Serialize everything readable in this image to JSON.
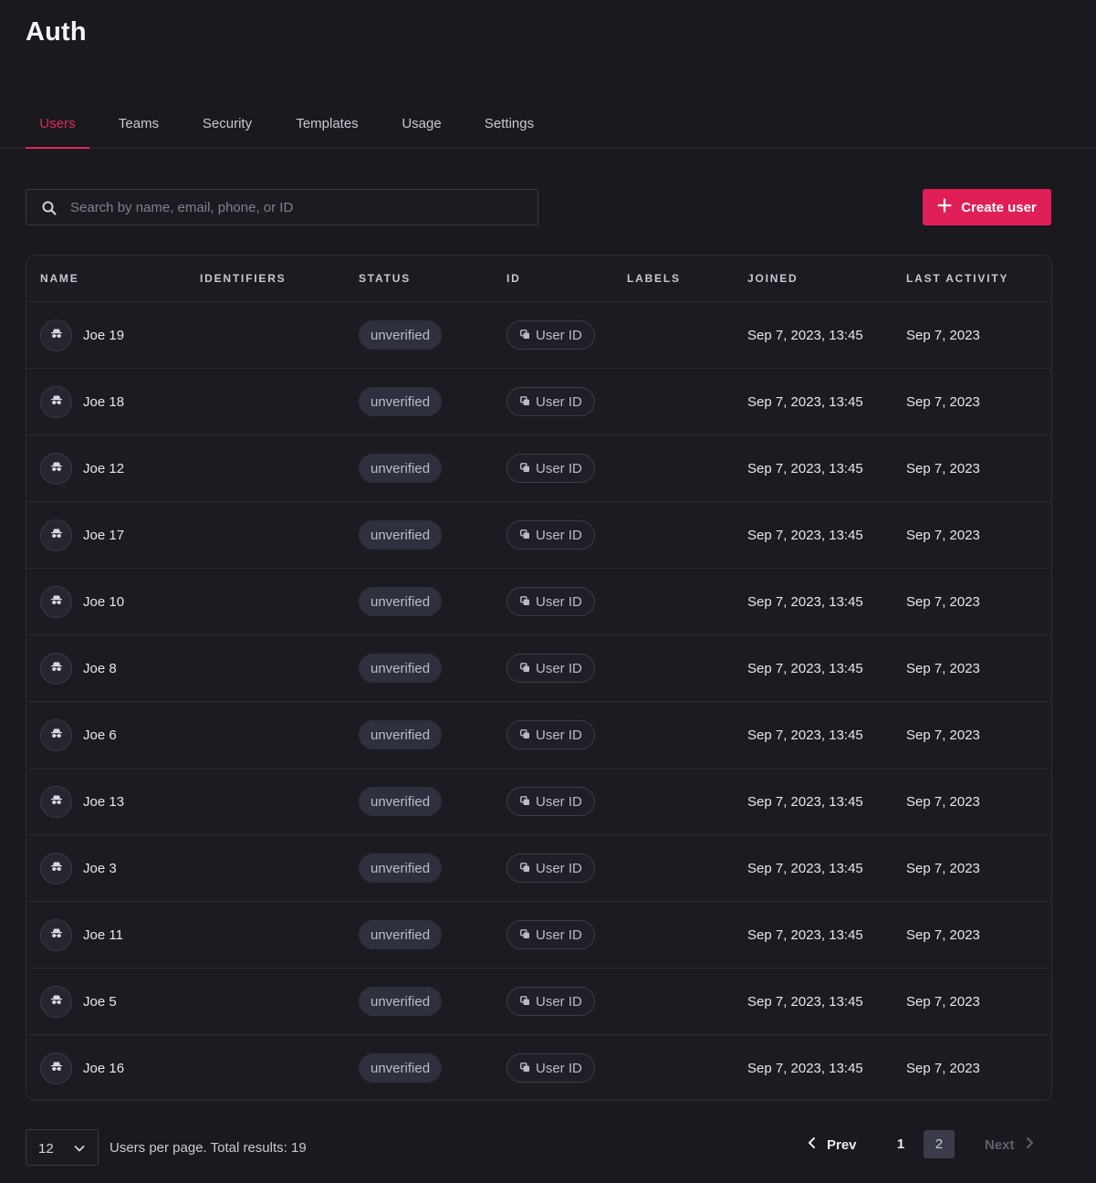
{
  "page": {
    "title": "Auth"
  },
  "tabs": [
    {
      "label": "Users",
      "active": true
    },
    {
      "label": "Teams"
    },
    {
      "label": "Security"
    },
    {
      "label": "Templates"
    },
    {
      "label": "Usage"
    },
    {
      "label": "Settings"
    }
  ],
  "search": {
    "placeholder": "Search by name, email, phone, or ID",
    "value": "",
    "icon": "search-icon"
  },
  "create_button": {
    "label": "Create user",
    "icon": "plus-icon",
    "color": "#e01e57"
  },
  "accent_color": "#e2275a",
  "table": {
    "columns": [
      "Name",
      "Identifiers",
      "Status",
      "ID",
      "Labels",
      "Joined",
      "Last Activity"
    ],
    "rows": [
      {
        "name": "Joe 19",
        "identifiers": "",
        "status": "unverified",
        "id_label": "User ID",
        "labels": "",
        "joined": "Sep 7, 2023, 13:45",
        "last_activity": "Sep 7, 2023"
      },
      {
        "name": "Joe 18",
        "identifiers": "",
        "status": "unverified",
        "id_label": "User ID",
        "labels": "",
        "joined": "Sep 7, 2023, 13:45",
        "last_activity": "Sep 7, 2023"
      },
      {
        "name": "Joe 12",
        "identifiers": "",
        "status": "unverified",
        "id_label": "User ID",
        "labels": "",
        "joined": "Sep 7, 2023, 13:45",
        "last_activity": "Sep 7, 2023"
      },
      {
        "name": "Joe 17",
        "identifiers": "",
        "status": "unverified",
        "id_label": "User ID",
        "labels": "",
        "joined": "Sep 7, 2023, 13:45",
        "last_activity": "Sep 7, 2023"
      },
      {
        "name": "Joe 10",
        "identifiers": "",
        "status": "unverified",
        "id_label": "User ID",
        "labels": "",
        "joined": "Sep 7, 2023, 13:45",
        "last_activity": "Sep 7, 2023"
      },
      {
        "name": "Joe 8",
        "identifiers": "",
        "status": "unverified",
        "id_label": "User ID",
        "labels": "",
        "joined": "Sep 7, 2023, 13:45",
        "last_activity": "Sep 7, 2023"
      },
      {
        "name": "Joe 6",
        "identifiers": "",
        "status": "unverified",
        "id_label": "User ID",
        "labels": "",
        "joined": "Sep 7, 2023, 13:45",
        "last_activity": "Sep 7, 2023"
      },
      {
        "name": "Joe 13",
        "identifiers": "",
        "status": "unverified",
        "id_label": "User ID",
        "labels": "",
        "joined": "Sep 7, 2023, 13:45",
        "last_activity": "Sep 7, 2023"
      },
      {
        "name": "Joe 3",
        "identifiers": "",
        "status": "unverified",
        "id_label": "User ID",
        "labels": "",
        "joined": "Sep 7, 2023, 13:45",
        "last_activity": "Sep 7, 2023"
      },
      {
        "name": "Joe 11",
        "identifiers": "",
        "status": "unverified",
        "id_label": "User ID",
        "labels": "",
        "joined": "Sep 7, 2023, 13:45",
        "last_activity": "Sep 7, 2023"
      },
      {
        "name": "Joe 5",
        "identifiers": "",
        "status": "unverified",
        "id_label": "User ID",
        "labels": "",
        "joined": "Sep 7, 2023, 13:45",
        "last_activity": "Sep 7, 2023"
      },
      {
        "name": "Joe 16",
        "identifiers": "",
        "status": "unverified",
        "id_label": "User ID",
        "labels": "",
        "joined": "Sep 7, 2023, 13:45",
        "last_activity": "Sep 7, 2023"
      }
    ]
  },
  "footer": {
    "per_page_value": "12",
    "total_text": "Users per page. Total results: 19",
    "prev_label": "Prev",
    "next_label": "Next",
    "pages": [
      "1",
      "2"
    ],
    "current_page": "2"
  }
}
